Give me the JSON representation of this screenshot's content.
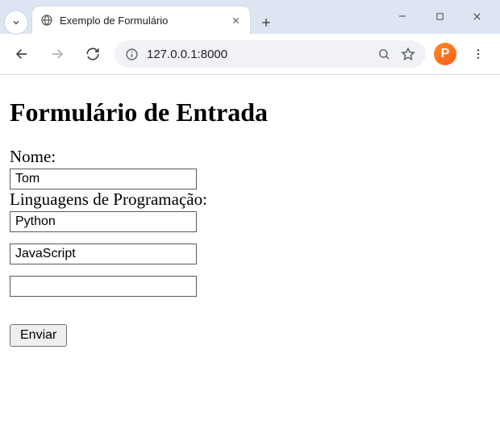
{
  "browser": {
    "tab_title": "Exemplo de Formulário",
    "url": "127.0.0.1:8000",
    "extension_letter": "P"
  },
  "page": {
    "heading": "Formulário de Entrada",
    "name_label": "Nome:",
    "name_value": "Tom",
    "languages_label": "Linguagens de Programação:",
    "languages": [
      "Python",
      "JavaScript",
      ""
    ],
    "submit_label": "Enviar"
  }
}
